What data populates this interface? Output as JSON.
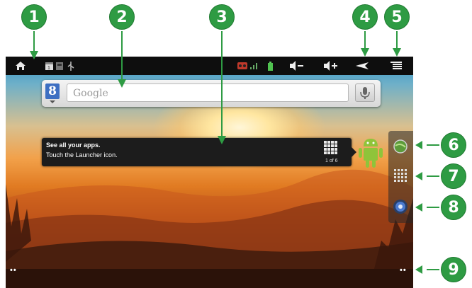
{
  "callouts": [
    "1",
    "2",
    "3",
    "4",
    "5",
    "6",
    "7",
    "8",
    "9"
  ],
  "statusbar": {
    "icons": [
      "home-icon",
      "calendar-icon",
      "sd-card-icon",
      "usb-icon",
      "signal-icon",
      "battery-icon",
      "volume-down-icon",
      "volume-up-icon",
      "back-icon",
      "menu-icon"
    ]
  },
  "search": {
    "logo": "8",
    "placeholder": "Google"
  },
  "tip": {
    "title": "See all your apps.",
    "body": "Touch the Launcher icon.",
    "page": "1 of 6"
  },
  "side_panel": {
    "items": [
      "browser-icon",
      "launcher-icon",
      "media-icon"
    ]
  },
  "dots": {
    "left": "••",
    "right": "••"
  },
  "colors": {
    "callout": "#2e9b43",
    "statusbar": "#0e0e0e",
    "tip": "#1c1c1c"
  }
}
